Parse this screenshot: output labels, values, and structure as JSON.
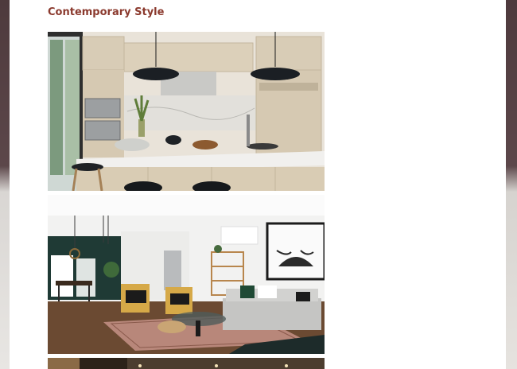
{
  "section": {
    "title": "Contemporary Style"
  },
  "gallery": {
    "images": [
      {
        "subject": "kitchen-photo"
      },
      {
        "subject": "living-room-photo"
      },
      {
        "subject": "partial-photo"
      }
    ]
  }
}
